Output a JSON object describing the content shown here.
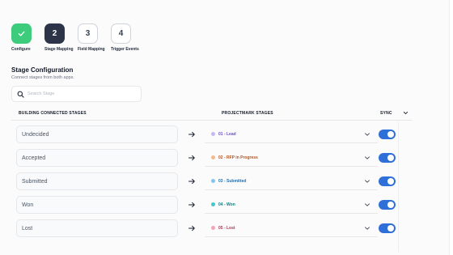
{
  "steps": [
    {
      "label": "Configure",
      "number": "",
      "state": "done"
    },
    {
      "label": "Stage Mapping",
      "number": "2",
      "state": "active"
    },
    {
      "label": "Field Mapping",
      "number": "3",
      "state": "todo"
    },
    {
      "label": "Trigger Events",
      "number": "4",
      "state": "todo"
    }
  ],
  "section": {
    "title": "Stage Configuration",
    "subtitle": "Connect stages from both apps."
  },
  "search": {
    "placeholder": "Search Stage",
    "value": ""
  },
  "table": {
    "col_source": "BUILDING CONNECTED STAGES",
    "col_target": "PROJECTMARK STAGES",
    "col_sync": "SYNC"
  },
  "rows": [
    {
      "source": "Undecided",
      "target": "01 - Lead",
      "dot_color": "#c7b8f0",
      "text_color": "#6d4fc4",
      "sync": true
    },
    {
      "source": "Accepted",
      "target": "02 - RFP in Progress",
      "dot_color": "#f6b98a",
      "text_color": "#b4541b",
      "sync": true
    },
    {
      "source": "Submitted",
      "target": "03 - Submitted",
      "dot_color": "#7fc7ef",
      "text_color": "#1e6fb3",
      "sync": true
    },
    {
      "source": "Won",
      "target": "04 - Won",
      "dot_color": "#3fc9c9",
      "text_color": "#127a7a",
      "sync": true
    },
    {
      "source": "Lost",
      "target": "05 - Lost",
      "dot_color": "#f5a3b5",
      "text_color": "#b03a55",
      "sync": true
    }
  ],
  "colors": {
    "accent": "#2f6fd8",
    "success": "#3dcb7c",
    "active_step": "#2b3547"
  }
}
